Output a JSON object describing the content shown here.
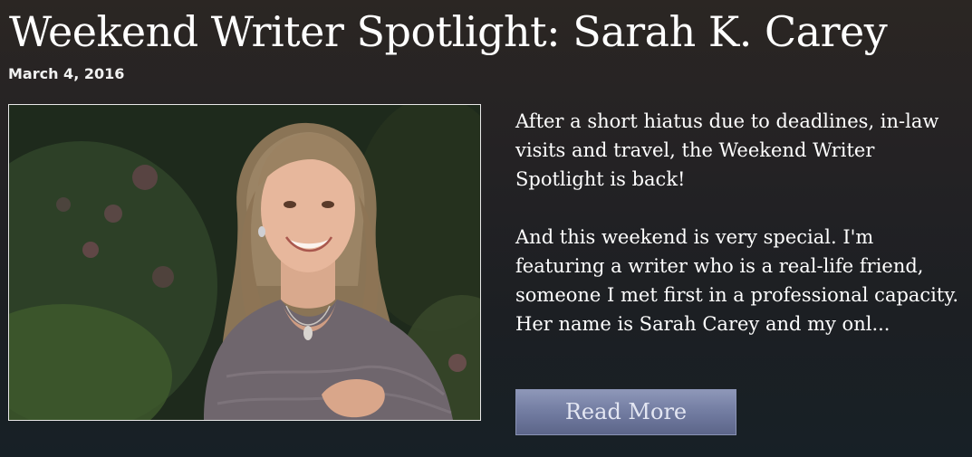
{
  "post": {
    "title": "Weekend Writer Spotlight: Sarah K. Carey",
    "date": "March 4, 2016",
    "photo_alt": "Portrait photo of a smiling woman with shoulder-length hair wearing a gray lace top, outdoors with green foliage behind her",
    "excerpt": [
      "After a short hiatus due to deadlines, in-law visits and travel, the Weekend Writer Spotlight is back!",
      "And this weekend is very special. I'm featuring a writer who is a real-life friend, someone I met first in a professional capacity. Her name is Sarah Carey and my onl..."
    ],
    "read_more_label": "Read More"
  },
  "colors": {
    "background_top": "#2b2623",
    "background_bottom": "#172026",
    "title_text": "#ffffff",
    "button_fill": "#747ea3",
    "button_text": "#e3e6f2"
  }
}
